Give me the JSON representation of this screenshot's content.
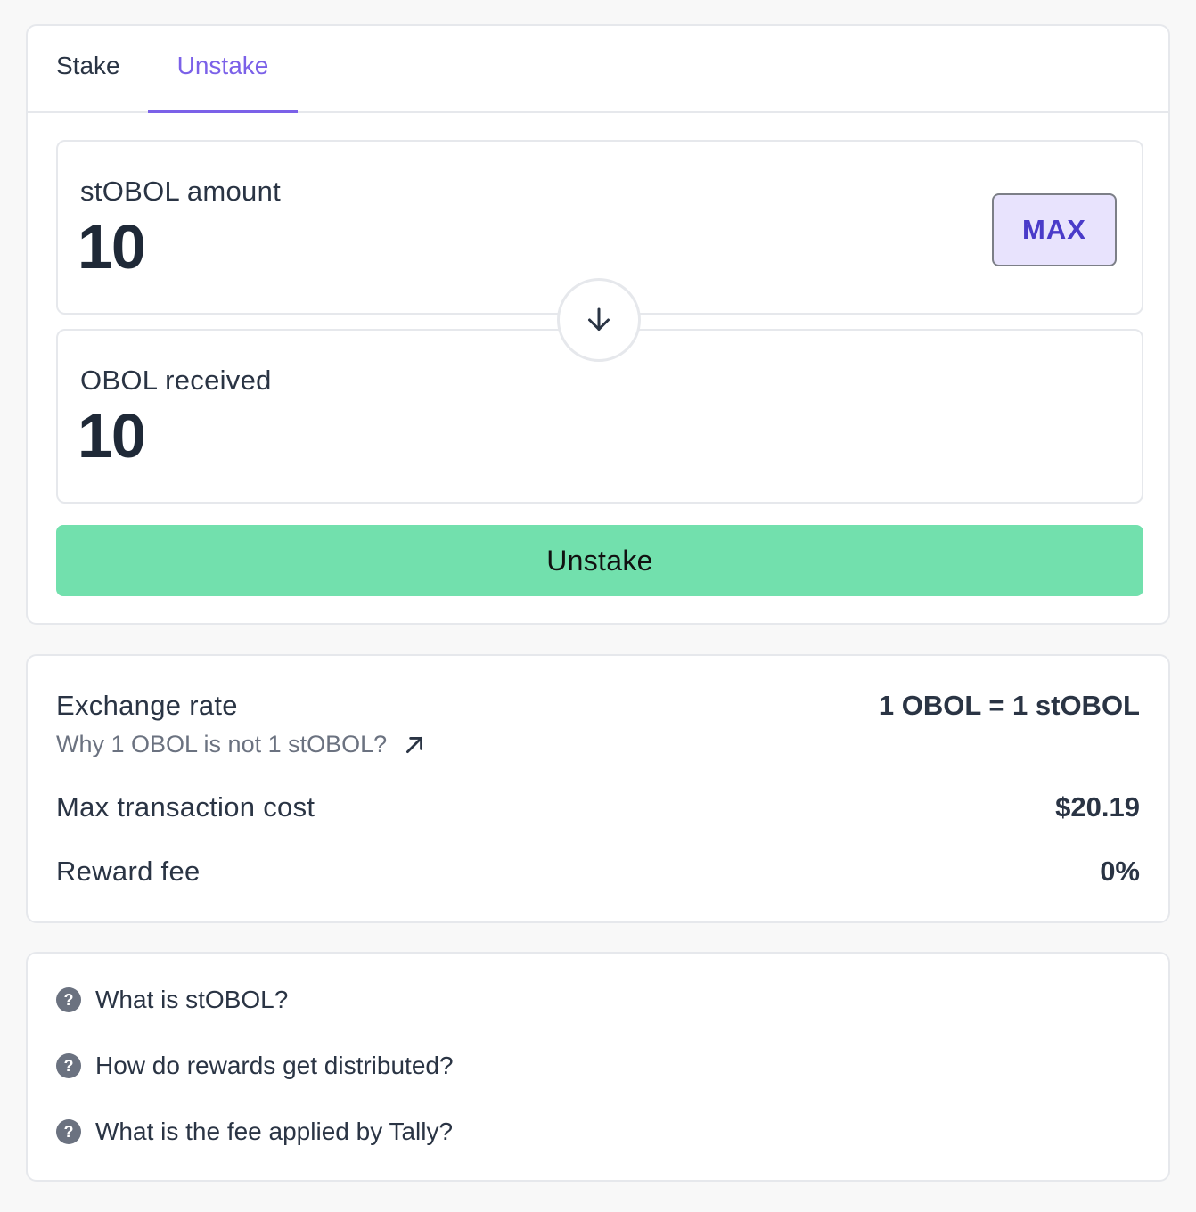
{
  "tabs": {
    "stake": "Stake",
    "unstake": "Unstake",
    "active": "Unstake"
  },
  "input_box": {
    "label": "stOBOL amount",
    "value": "10",
    "max_label": "MAX"
  },
  "output_box": {
    "label": "OBOL received",
    "value": "10"
  },
  "swap_icon": "arrow-down-icon",
  "primary_button": {
    "label": "Unstake"
  },
  "info": {
    "exchange_rate_label": "Exchange rate",
    "exchange_rate_value": "1 OBOL = 1 stOBOL",
    "exchange_rate_link": "Why 1 OBOL is not 1 stOBOL?",
    "tx_cost_label": "Max transaction cost",
    "tx_cost_value": "$20.19",
    "reward_fee_label": "Reward fee",
    "reward_fee_value": "0%"
  },
  "faq": [
    {
      "question": "What is stOBOL?"
    },
    {
      "question": "How do rewards get distributed?"
    },
    {
      "question": "What is the fee applied by Tally?"
    }
  ],
  "colors": {
    "accent": "#7b61e8",
    "primary_button": "#72e0ad",
    "max_button_bg": "#e8e3fd",
    "max_button_text": "#4a3bc9"
  }
}
